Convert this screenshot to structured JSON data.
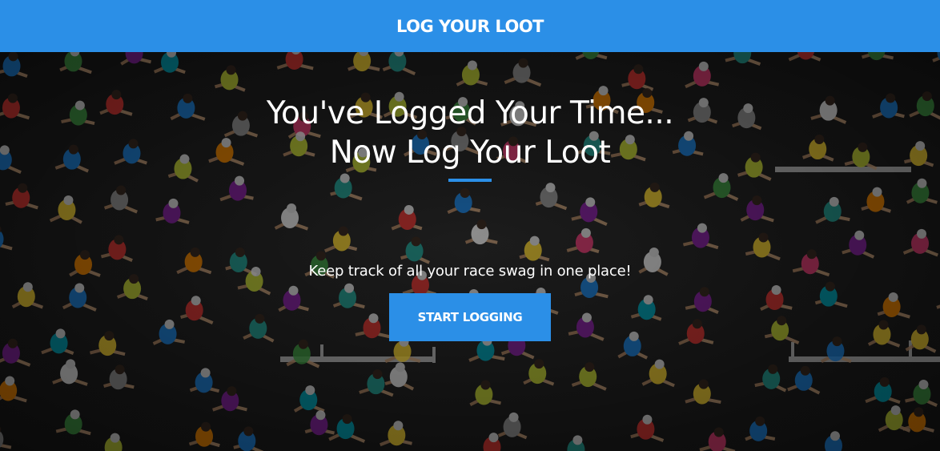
{
  "navbar": {
    "brand": "LOG YOUR LOOT"
  },
  "hero": {
    "background": "aerial-marathon-runners-photo",
    "heading_line1": "You've Logged Your Time...",
    "heading_line2": "Now Log Your Loot",
    "tagline": "Keep track of all your race swag in one place!",
    "cta_label": "START LOGGING"
  },
  "colors": {
    "accent": "#2b8fe7",
    "text": "#ffffff",
    "road": "#232323"
  }
}
